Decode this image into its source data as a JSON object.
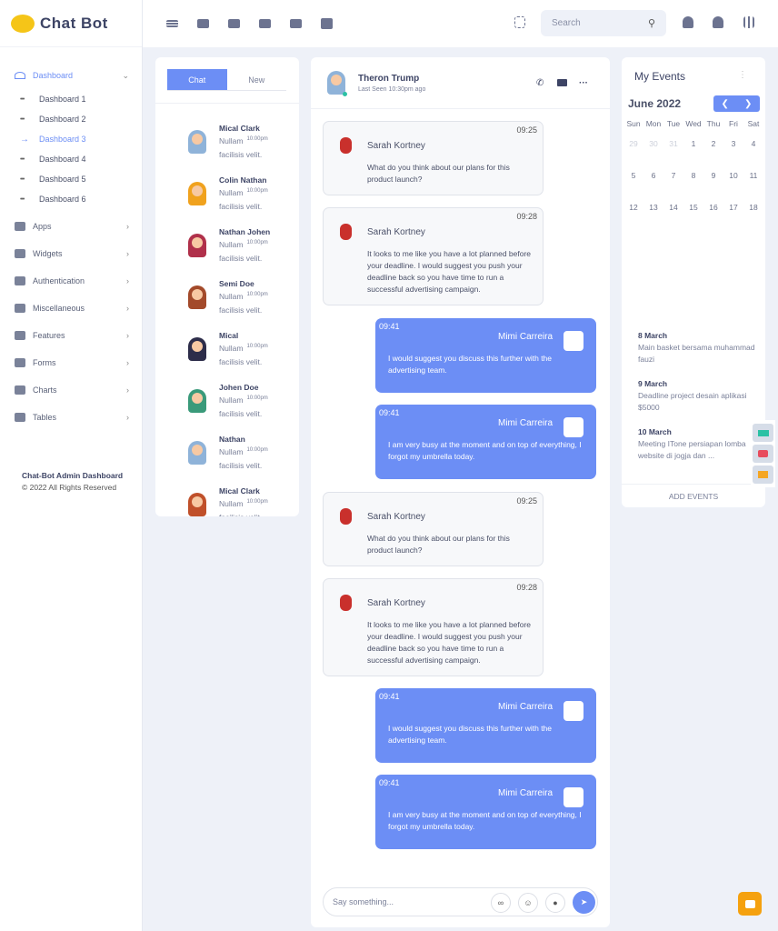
{
  "brand": {
    "name": "Chat Bot",
    "accent": "#6c8ef5"
  },
  "sidebar": {
    "dashboard": "Dashboard",
    "sub": [
      "Dashboard 1",
      "Dashboard 2",
      "Dashboard 3",
      "Dashboard 4",
      "Dashboard 5",
      "Dashboard 6"
    ],
    "active_sub": 2,
    "items": [
      "Apps",
      "Widgets",
      "Authentication",
      "Miscellaneous",
      "Features",
      "Forms",
      "Charts",
      "Tables"
    ],
    "footer_title": "Chat-Bot Admin Dashboard",
    "footer_copy": "© 2022 All Rights Reserved"
  },
  "header": {
    "search_placeholder": "Search",
    "icons": [
      "menu-icon",
      "chat-icon",
      "mail-icon",
      "inbox-icon",
      "calendar-icon",
      "star-icon"
    ],
    "right_icons": [
      "scan-icon",
      "bell-icon",
      "user-icon",
      "sliders-icon"
    ]
  },
  "contacts": {
    "tabs": [
      "Chat",
      "New"
    ],
    "list": [
      {
        "name": "Mical Clark",
        "msg1": "Nullam",
        "msg2": "facilisis velit.",
        "time": "10:00pm",
        "color": "#8fb3d9"
      },
      {
        "name": "Colin Nathan",
        "msg1": "Nullam",
        "msg2": "facilisis velit.",
        "time": "10:00pm",
        "color": "#f0a21e"
      },
      {
        "name": "Nathan Johen",
        "msg1": "Nullam",
        "msg2": "facilisis velit.",
        "time": "10:00pm",
        "color": "#b0304a"
      },
      {
        "name": "Semi Doe",
        "msg1": "Nullam",
        "msg2": "facilisis velit.",
        "time": "10:00pm",
        "color": "#a34a2a"
      },
      {
        "name": "Mical",
        "msg1": "Nullam",
        "msg2": "facilisis velit.",
        "time": "10:00pm",
        "color": "#2d2d4a"
      },
      {
        "name": "Johen Doe",
        "msg1": "Nullam",
        "msg2": "facilisis velit.",
        "time": "10:00pm",
        "color": "#3a9a7a"
      },
      {
        "name": "Nathan",
        "msg1": "Nullam",
        "msg2": "facilisis velit.",
        "time": "10:00pm",
        "color": "#8fb3d9"
      },
      {
        "name": "Mical Clark",
        "msg1": "Nullam",
        "msg2": "facilisis velit.",
        "time": "10:00pm",
        "color": "#c0502a"
      }
    ]
  },
  "chat": {
    "name": "Theron Trump",
    "last_seen": "Last Seen 10:30pm ago",
    "input_placeholder": "Say something...",
    "messages": [
      {
        "dir": "in",
        "sender": "Sarah Kortney",
        "time": "09:25",
        "text": "What do you think about our plans for this product launch?"
      },
      {
        "dir": "in",
        "sender": "Sarah Kortney",
        "time": "09:28",
        "text": "It looks to me like you have a lot planned before your deadline. I would suggest you push your deadline back so you have time to run a successful advertising campaign."
      },
      {
        "dir": "out",
        "sender": "Mimi Carreira",
        "time": "09:41",
        "text": "I would suggest you discuss this further with the advertising team."
      },
      {
        "dir": "out",
        "sender": "Mimi Carreira",
        "time": "09:41",
        "text": "I am very busy at the moment and on top of everything, I forgot my umbrella today."
      },
      {
        "dir": "in",
        "sender": "Sarah Kortney",
        "time": "09:25",
        "text": "What do you think about our plans for this product launch?"
      },
      {
        "dir": "in",
        "sender": "Sarah Kortney",
        "time": "09:28",
        "text": "It looks to me like you have a lot planned before your deadline. I would suggest you push your deadline back so you have time to run a successful advertising campaign."
      },
      {
        "dir": "out",
        "sender": "Mimi Carreira",
        "time": "09:41",
        "text": "I would suggest you discuss this further with the advertising team."
      },
      {
        "dir": "out",
        "sender": "Mimi Carreira",
        "time": "09:41",
        "text": "I am very busy at the moment and on top of everything, I forgot my umbrella today."
      }
    ]
  },
  "events": {
    "title": "My Events",
    "month": "June 2022",
    "weekdays": [
      "Sun",
      "Mon",
      "Tue",
      "Wed",
      "Thu",
      "Fri",
      "Sat"
    ],
    "days": [
      "29",
      "30",
      "31",
      "1",
      "2",
      "3",
      "4",
      "5",
      "6",
      "7",
      "8",
      "9",
      "10",
      "11",
      "12",
      "13",
      "14",
      "15",
      "16",
      "17",
      "18"
    ],
    "muted_days": 3,
    "list": [
      {
        "date": "8 March",
        "text": "Main basket bersama muhammad fauzi"
      },
      {
        "date": "9 March",
        "text": "Deadline project desain aplikasi $5000"
      },
      {
        "date": "10 March",
        "text": "Meeting ITone persiapan lomba website di jogja dan ..."
      }
    ],
    "add_label": "ADD EVENTS"
  }
}
